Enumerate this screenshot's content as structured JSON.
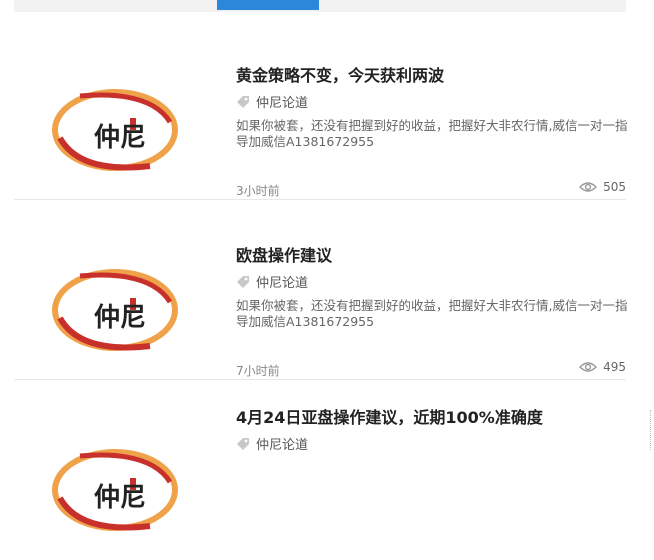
{
  "colors": {
    "accent": "#2b87da",
    "logo_red": "#c8312b",
    "logo_orange": "#f0a24a"
  },
  "articles": [
    {
      "title": "黄金策略不变，今天获利两波",
      "tag": "仲尼论道",
      "excerpt": "如果你被套，还没有把握到好的收益，把握好大非农行情,威信一对一指导加威信A1381672955",
      "time": "3小时前",
      "views": "505",
      "logo_text": "仲尼"
    },
    {
      "title": "欧盘操作建议",
      "tag": "仲尼论道",
      "excerpt": "如果你被套，还没有把握到好的收益，把握好大非农行情,威信一对一指导加威信A1381672955",
      "time": "7小时前",
      "views": "495",
      "logo_text": "仲尼"
    },
    {
      "title": "4月24日亚盘操作建议，近期100%准确度",
      "tag": "仲尼论道",
      "logo_text": "仲尼"
    }
  ]
}
